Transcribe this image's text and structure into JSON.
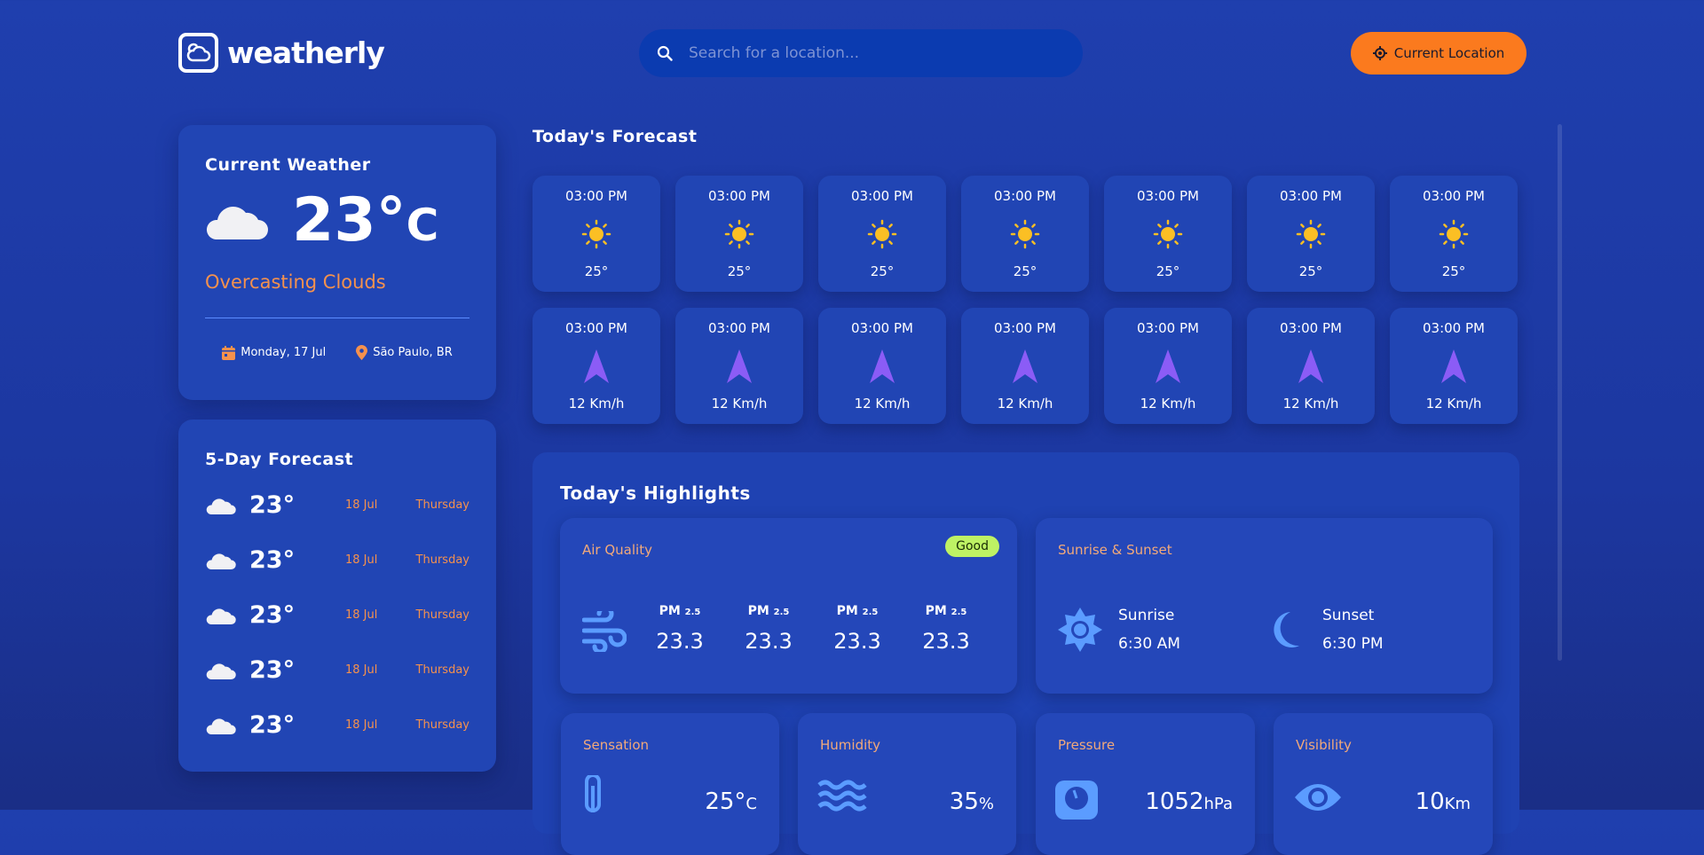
{
  "app": {
    "name": "weatherly"
  },
  "search": {
    "placeholder": "Search for a location..."
  },
  "location_button": {
    "label": "Current Location"
  },
  "current": {
    "title": "Current Weather",
    "temp": "23°",
    "unit": "C",
    "description": "Overcasting Clouds",
    "date": "Monday, 17 Jul",
    "location": "São Paulo, BR"
  },
  "five_day": {
    "title": "5-Day Forecast",
    "items": [
      {
        "temp": "23°",
        "date": "18 Jul",
        "day": "Thursday"
      },
      {
        "temp": "23°",
        "date": "18 Jul",
        "day": "Thursday"
      },
      {
        "temp": "23°",
        "date": "18 Jul",
        "day": "Thursday"
      },
      {
        "temp": "23°",
        "date": "18 Jul",
        "day": "Thursday"
      },
      {
        "temp": "23°",
        "date": "18 Jul",
        "day": "Thursday"
      }
    ]
  },
  "today": {
    "title": "Today's Forecast",
    "temps": [
      {
        "time": "03:00 PM",
        "value": "25°"
      },
      {
        "time": "03:00 PM",
        "value": "25°"
      },
      {
        "time": "03:00 PM",
        "value": "25°"
      },
      {
        "time": "03:00 PM",
        "value": "25°"
      },
      {
        "time": "03:00 PM",
        "value": "25°"
      },
      {
        "time": "03:00 PM",
        "value": "25°"
      },
      {
        "time": "03:00 PM",
        "value": "25°"
      }
    ],
    "winds": [
      {
        "time": "03:00 PM",
        "value": "12 Km/h"
      },
      {
        "time": "03:00 PM",
        "value": "12 Km/h"
      },
      {
        "time": "03:00 PM",
        "value": "12 Km/h"
      },
      {
        "time": "03:00 PM",
        "value": "12 Km/h"
      },
      {
        "time": "03:00 PM",
        "value": "12 Km/h"
      },
      {
        "time": "03:00 PM",
        "value": "12 Km/h"
      },
      {
        "time": "03:00 PM",
        "value": "12 Km/h"
      }
    ]
  },
  "highlights": {
    "title": "Today's Highlights",
    "air": {
      "label": "Air Quality",
      "badge": "Good",
      "items": [
        {
          "name": "PM",
          "sub": "2.5",
          "value": "23.3"
        },
        {
          "name": "PM",
          "sub": "2.5",
          "value": "23.3"
        },
        {
          "name": "PM",
          "sub": "2.5",
          "value": "23.3"
        },
        {
          "name": "PM",
          "sub": "2.5",
          "value": "23.3"
        }
      ]
    },
    "sun": {
      "label": "Sunrise & Sunset",
      "sunrise_label": "Sunrise",
      "sunrise": "6:30 AM",
      "sunset_label": "Sunset",
      "sunset": "6:30 PM"
    },
    "sensation": {
      "label": "Sensation",
      "value": "25°",
      "unit": "C"
    },
    "humidity": {
      "label": "Humidity",
      "value": "35",
      "unit": "%"
    },
    "pressure": {
      "label": "Pressure",
      "value": "1052",
      "unit": "hPa"
    },
    "visibility": {
      "label": "Visibility",
      "value": "10",
      "unit": "Km"
    }
  },
  "colors": {
    "accent": "#fb7a1e",
    "orange_text": "#f5914d",
    "badge": "#bef264",
    "icon_blue": "#5b9cff",
    "arrow": "#8b5cf6",
    "sun": "#fbbf24"
  }
}
